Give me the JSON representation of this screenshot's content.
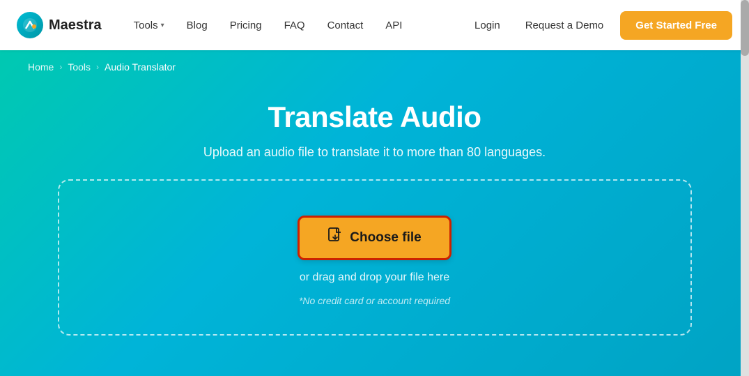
{
  "navbar": {
    "logo_text": "Maestra",
    "nav_items": [
      {
        "label": "Tools",
        "has_dropdown": true
      },
      {
        "label": "Blog",
        "has_dropdown": false
      },
      {
        "label": "Pricing",
        "has_dropdown": false
      },
      {
        "label": "FAQ",
        "has_dropdown": false
      },
      {
        "label": "Contact",
        "has_dropdown": false
      },
      {
        "label": "API",
        "has_dropdown": false
      }
    ],
    "login_label": "Login",
    "demo_label": "Request a Demo",
    "cta_label": "Get Started Free"
  },
  "breadcrumb": {
    "home": "Home",
    "tools": "Tools",
    "current": "Audio Translator"
  },
  "hero": {
    "title": "Translate Audio",
    "subtitle": "Upload an audio file to translate it to more than 80 languages."
  },
  "dropzone": {
    "choose_file_label": "Choose file",
    "drag_drop_text": "or drag and drop your file here",
    "note_text": "*No credit card or account required"
  }
}
